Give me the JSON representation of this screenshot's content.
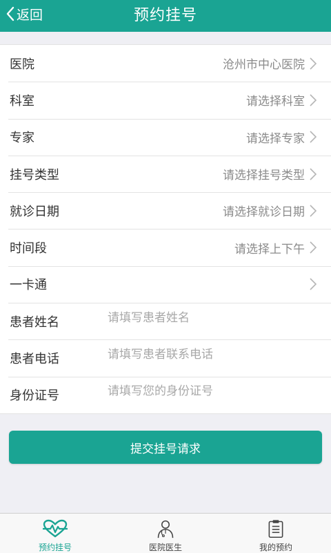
{
  "header": {
    "back_label": "返回",
    "title": "预约挂号"
  },
  "form": {
    "rows": [
      {
        "label": "医院",
        "value": "沧州市中心医院"
      },
      {
        "label": "科室",
        "value": "请选择科室"
      },
      {
        "label": "专家",
        "value": "请选择专家"
      },
      {
        "label": "挂号类型",
        "value": "请选择挂号类型"
      },
      {
        "label": "就诊日期",
        "value": "请选择就诊日期"
      },
      {
        "label": "时间段",
        "value": "请选择上下午"
      },
      {
        "label": "一卡通",
        "value": ""
      }
    ],
    "inputs": [
      {
        "label": "患者姓名",
        "placeholder": "请填写患者姓名"
      },
      {
        "label": "患者电话",
        "placeholder": "请填写患者联系电话"
      },
      {
        "label": "身份证号",
        "placeholder": "请填写您的身份证号"
      }
    ]
  },
  "submit_label": "提交挂号请求",
  "tabbar": {
    "tabs": [
      {
        "label": "预约挂号",
        "icon": "heartbeat-icon",
        "active": true
      },
      {
        "label": "医院医生",
        "icon": "doctor-icon",
        "active": false
      },
      {
        "label": "我的预约",
        "icon": "clipboard-icon",
        "active": false
      }
    ]
  },
  "colors": {
    "accent": "#1aa493",
    "background": "#efeff4"
  }
}
